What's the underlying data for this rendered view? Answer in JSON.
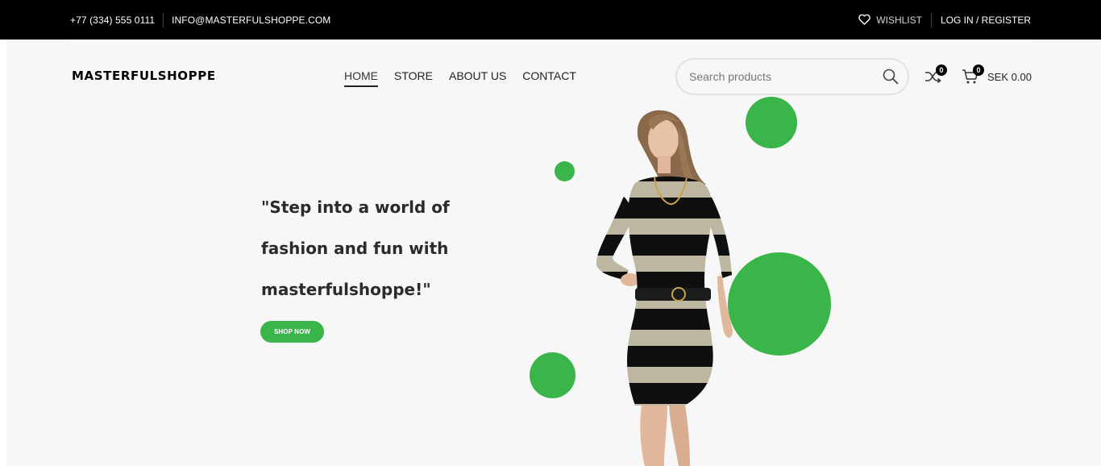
{
  "topbar": {
    "phone": "+77 (334) 555 0111",
    "email": "INFO@MASTERFULSHOPPE.COM",
    "wishlist_label": "WISHLIST",
    "login_label": "LOG IN / REGISTER"
  },
  "header": {
    "logo": "MASTERFULSHOPPE",
    "nav": [
      "HOME",
      "STORE",
      "ABOUT US",
      "CONTACT"
    ],
    "active_nav": "HOME",
    "search_placeholder": "Search products",
    "compare_count": "0",
    "cart_count": "0",
    "cart_total": "SEK 0.00"
  },
  "hero": {
    "headline_line1": "\"Step into a world of",
    "headline_line2": "fashion and fun with",
    "headline_line3": "masterfulshoppe!\"",
    "button_label": "SHOP NOW"
  },
  "colors": {
    "accent": "#3ab54a",
    "topbar_bg": "#000000",
    "stage_bg": "#f7f7f7"
  },
  "icons": [
    "heart-icon",
    "search-icon",
    "compare-icon",
    "cart-icon"
  ]
}
